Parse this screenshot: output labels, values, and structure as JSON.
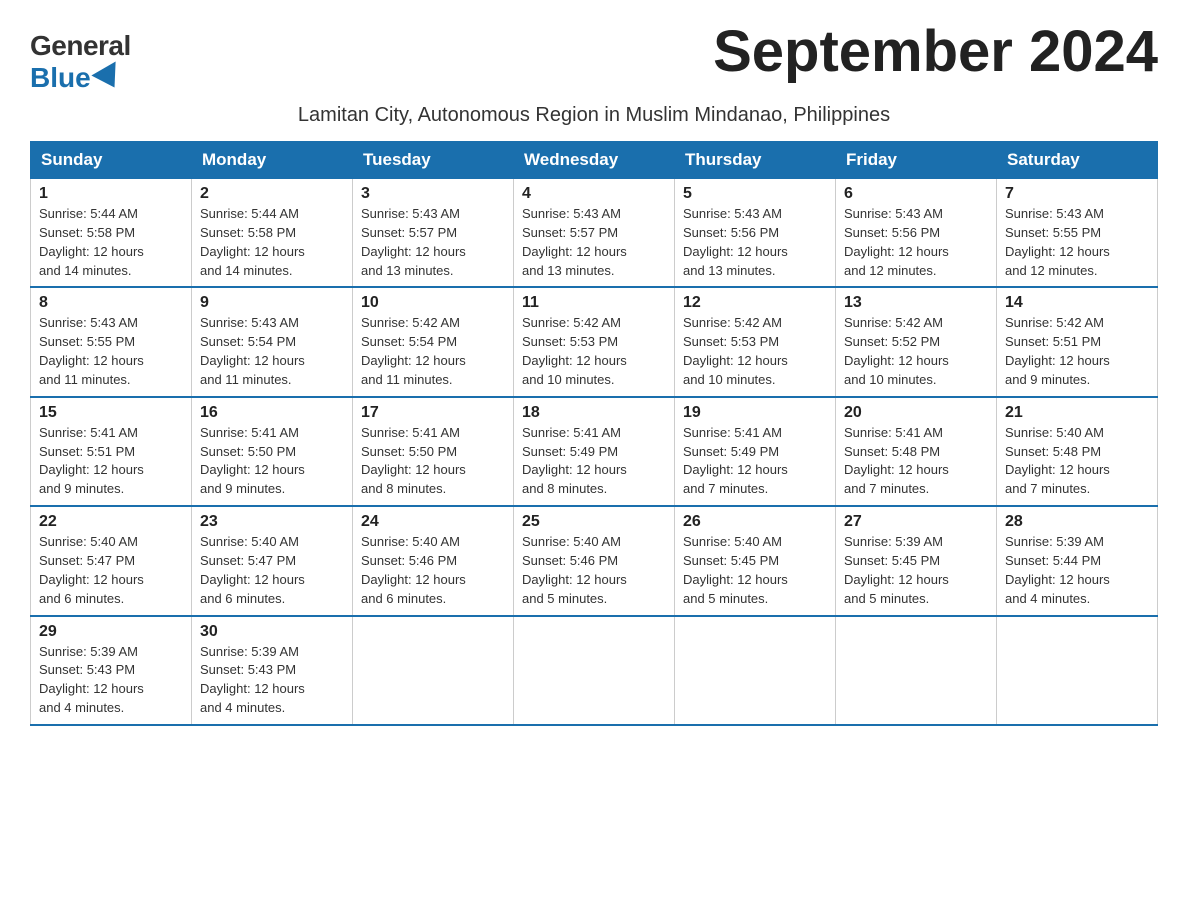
{
  "logo": {
    "general": "General",
    "blue": "Blue"
  },
  "header": {
    "month_year": "September 2024",
    "subtitle": "Lamitan City, Autonomous Region in Muslim Mindanao, Philippines"
  },
  "weekdays": [
    "Sunday",
    "Monday",
    "Tuesday",
    "Wednesday",
    "Thursday",
    "Friday",
    "Saturday"
  ],
  "weeks": [
    [
      {
        "day": "1",
        "sunrise": "5:44 AM",
        "sunset": "5:58 PM",
        "daylight": "12 hours and 14 minutes."
      },
      {
        "day": "2",
        "sunrise": "5:44 AM",
        "sunset": "5:58 PM",
        "daylight": "12 hours and 14 minutes."
      },
      {
        "day": "3",
        "sunrise": "5:43 AM",
        "sunset": "5:57 PM",
        "daylight": "12 hours and 13 minutes."
      },
      {
        "day": "4",
        "sunrise": "5:43 AM",
        "sunset": "5:57 PM",
        "daylight": "12 hours and 13 minutes."
      },
      {
        "day": "5",
        "sunrise": "5:43 AM",
        "sunset": "5:56 PM",
        "daylight": "12 hours and 13 minutes."
      },
      {
        "day": "6",
        "sunrise": "5:43 AM",
        "sunset": "5:56 PM",
        "daylight": "12 hours and 12 minutes."
      },
      {
        "day": "7",
        "sunrise": "5:43 AM",
        "sunset": "5:55 PM",
        "daylight": "12 hours and 12 minutes."
      }
    ],
    [
      {
        "day": "8",
        "sunrise": "5:43 AM",
        "sunset": "5:55 PM",
        "daylight": "12 hours and 11 minutes."
      },
      {
        "day": "9",
        "sunrise": "5:43 AM",
        "sunset": "5:54 PM",
        "daylight": "12 hours and 11 minutes."
      },
      {
        "day": "10",
        "sunrise": "5:42 AM",
        "sunset": "5:54 PM",
        "daylight": "12 hours and 11 minutes."
      },
      {
        "day": "11",
        "sunrise": "5:42 AM",
        "sunset": "5:53 PM",
        "daylight": "12 hours and 10 minutes."
      },
      {
        "day": "12",
        "sunrise": "5:42 AM",
        "sunset": "5:53 PM",
        "daylight": "12 hours and 10 minutes."
      },
      {
        "day": "13",
        "sunrise": "5:42 AM",
        "sunset": "5:52 PM",
        "daylight": "12 hours and 10 minutes."
      },
      {
        "day": "14",
        "sunrise": "5:42 AM",
        "sunset": "5:51 PM",
        "daylight": "12 hours and 9 minutes."
      }
    ],
    [
      {
        "day": "15",
        "sunrise": "5:41 AM",
        "sunset": "5:51 PM",
        "daylight": "12 hours and 9 minutes."
      },
      {
        "day": "16",
        "sunrise": "5:41 AM",
        "sunset": "5:50 PM",
        "daylight": "12 hours and 9 minutes."
      },
      {
        "day": "17",
        "sunrise": "5:41 AM",
        "sunset": "5:50 PM",
        "daylight": "12 hours and 8 minutes."
      },
      {
        "day": "18",
        "sunrise": "5:41 AM",
        "sunset": "5:49 PM",
        "daylight": "12 hours and 8 minutes."
      },
      {
        "day": "19",
        "sunrise": "5:41 AM",
        "sunset": "5:49 PM",
        "daylight": "12 hours and 7 minutes."
      },
      {
        "day": "20",
        "sunrise": "5:41 AM",
        "sunset": "5:48 PM",
        "daylight": "12 hours and 7 minutes."
      },
      {
        "day": "21",
        "sunrise": "5:40 AM",
        "sunset": "5:48 PM",
        "daylight": "12 hours and 7 minutes."
      }
    ],
    [
      {
        "day": "22",
        "sunrise": "5:40 AM",
        "sunset": "5:47 PM",
        "daylight": "12 hours and 6 minutes."
      },
      {
        "day": "23",
        "sunrise": "5:40 AM",
        "sunset": "5:47 PM",
        "daylight": "12 hours and 6 minutes."
      },
      {
        "day": "24",
        "sunrise": "5:40 AM",
        "sunset": "5:46 PM",
        "daylight": "12 hours and 6 minutes."
      },
      {
        "day": "25",
        "sunrise": "5:40 AM",
        "sunset": "5:46 PM",
        "daylight": "12 hours and 5 minutes."
      },
      {
        "day": "26",
        "sunrise": "5:40 AM",
        "sunset": "5:45 PM",
        "daylight": "12 hours and 5 minutes."
      },
      {
        "day": "27",
        "sunrise": "5:39 AM",
        "sunset": "5:45 PM",
        "daylight": "12 hours and 5 minutes."
      },
      {
        "day": "28",
        "sunrise": "5:39 AM",
        "sunset": "5:44 PM",
        "daylight": "12 hours and 4 minutes."
      }
    ],
    [
      {
        "day": "29",
        "sunrise": "5:39 AM",
        "sunset": "5:43 PM",
        "daylight": "12 hours and 4 minutes."
      },
      {
        "day": "30",
        "sunrise": "5:39 AM",
        "sunset": "5:43 PM",
        "daylight": "12 hours and 4 minutes."
      },
      null,
      null,
      null,
      null,
      null
    ]
  ]
}
